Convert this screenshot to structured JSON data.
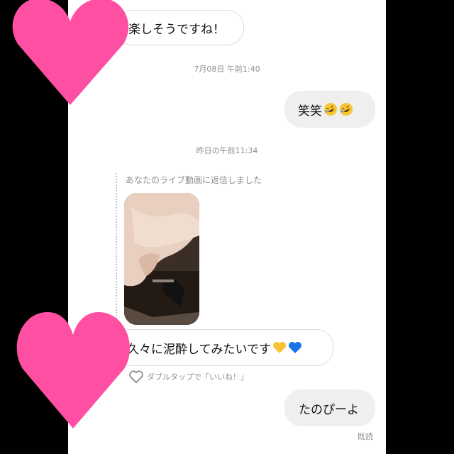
{
  "messages": [
    {
      "text": "楽しそうですね！"
    },
    {
      "text": "笑笑"
    },
    {
      "text": "久々に泥酔してみたいです"
    },
    {
      "text": "たのぴーよ"
    }
  ],
  "timestamps": [
    "7月08日 午前1:40",
    "昨日の午前11:34"
  ],
  "reply_label": "あなたのライブ動画に返信しました",
  "like_hint": "ダブルタップで「いいね！」",
  "read_receipt": "既読",
  "colors": {
    "heart": "#ff4fa3",
    "bubble_out": "#efefef",
    "bubble_in_border": "#dcdcdc"
  },
  "icons": [
    "heart-outline-icon",
    "rofl-emoji",
    "yellow-heart-emoji",
    "blue-heart-emoji"
  ]
}
